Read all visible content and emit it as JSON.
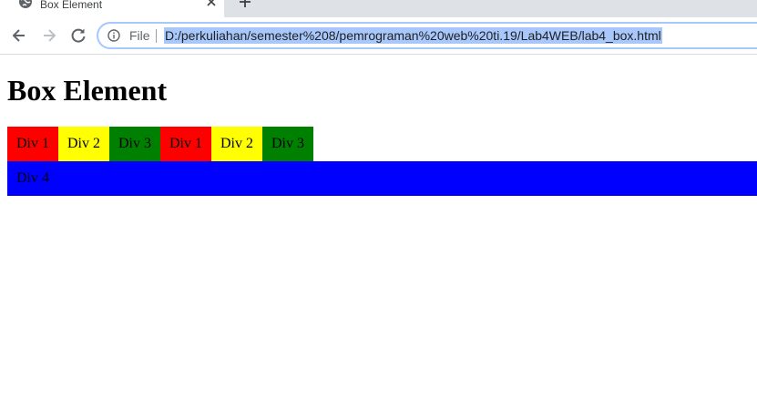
{
  "browser": {
    "tab": {
      "title": "Box Element"
    },
    "address": {
      "scheme": "File",
      "url": "D:/perkuliahan/semester%208/pemrograman%20web%20ti.19/Lab4WEB/lab4_box.html"
    }
  },
  "page": {
    "heading": "Box Element",
    "row_boxes": [
      {
        "label": "Div 1",
        "color": "#ff0000"
      },
      {
        "label": "Div 2",
        "color": "#ffff00"
      },
      {
        "label": "Div 3",
        "color": "#008000"
      },
      {
        "label": "Div 1",
        "color": "#ff0000"
      },
      {
        "label": "Div 2",
        "color": "#ffff00"
      },
      {
        "label": "Div 3",
        "color": "#008000"
      }
    ],
    "full_box": {
      "label": "Div 4",
      "color": "#0000ff"
    }
  },
  "icons": {
    "tab_favicon": "globe-icon",
    "tab_close": "close-icon",
    "new_tab": "plus-icon",
    "back": "arrow-left-icon",
    "forward": "arrow-right-icon",
    "reload": "reload-icon",
    "site_info": "info-icon"
  }
}
